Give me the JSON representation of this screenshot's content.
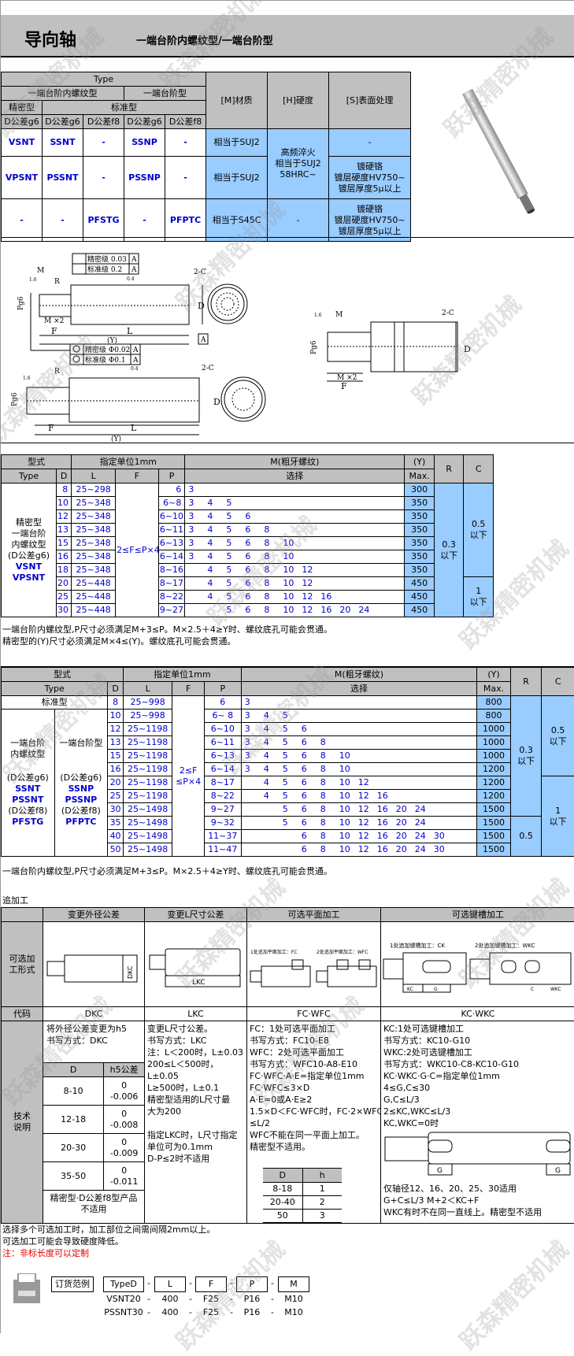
{
  "header": {
    "title": "导向轴",
    "subtitle": "一端台阶内螺纹型/一端台阶型"
  },
  "type_table": {
    "type_label": "Type",
    "group1": "一端台阶内螺纹型",
    "group2": "一端台阶型",
    "sub_precision": "精密型",
    "sub_standard": "标准型",
    "tol_cols": [
      "D公差g6",
      "D公差g6",
      "D公差f8",
      "D公差g6",
      "D公差f8"
    ],
    "material_header": "[M]材质",
    "hardness_header": "[H]硬度",
    "surface_header": "[S]表面处理",
    "rows": [
      {
        "codes": [
          "VSNT",
          "SSNT",
          "-",
          "SSNP",
          "-"
        ],
        "material": "相当于SUJ2",
        "surface": "-"
      },
      {
        "codes": [
          "VPSNT",
          "PSSNT",
          "-",
          "PSSNP",
          "-"
        ],
        "material": "相当于SUJ2",
        "surface": "镀硬铬\n镀层硬度HV750~\n镀层厚度5μ以上"
      },
      {
        "codes": [
          "-",
          "-",
          "PFSTG",
          "-",
          "PFPTC"
        ],
        "material": "相当于S45C",
        "hardness": "-",
        "surface": "镀硬铬\n镀层硬度HV750~\n镀层厚度5μ以上"
      }
    ],
    "hardness_merged": "高频淬火\n相当于SUJ2\n58HRC~"
  },
  "drawing_labels": {
    "perp_precision": "精密级 0.03",
    "perp_standard": "标准级 0.2",
    "conc_precision": "精密级 Φ0.02",
    "conc_standard": "标准级 Φ0.1",
    "datum": "A",
    "chamfer": "2-C",
    "dim_L": "L",
    "dim_F": "F",
    "dim_Y": "(Y)",
    "dim_D": "D",
    "dim_P": "Pg6",
    "dim_M": "M",
    "dim_M2": "M ×2",
    "radius": "R",
    "rough_16": "1.6",
    "rough_04": "0.4"
  },
  "table1": {
    "h_type": "型式",
    "h_unit": "指定单位1mm",
    "h_m": "M(粗牙螺纹)",
    "h_y": "(Y)",
    "h_r": "R",
    "h_c": "C",
    "h_type_en": "Type",
    "h_d": "D",
    "h_l": "L",
    "h_f": "F",
    "h_p": "P",
    "h_select": "选择",
    "h_max": "Max.",
    "type_cell": "精密型\n一端台阶\n内螺纹型\n(D公差g6)",
    "type_codes": [
      "VSNT",
      "VPSNT"
    ],
    "f_cell": "2≤F≤P×4",
    "r_cell": "0.3\n以下",
    "c_cells": [
      "0.5\n以下",
      "1\n以下"
    ],
    "rows": [
      {
        "d": "8",
        "l": "25~298",
        "p": "6",
        "m": [
          "3",
          "",
          "",
          "",
          "",
          "",
          "",
          "",
          ""
        ],
        "y": "300"
      },
      {
        "d": "10",
        "l": "25~348",
        "p": "6~8",
        "m": [
          "3",
          "4",
          "5",
          "",
          "",
          "",
          "",
          "",
          ""
        ],
        "y": "350"
      },
      {
        "d": "12",
        "l": "25~348",
        "p": "6~10",
        "m": [
          "3",
          "4",
          "5",
          "6",
          "",
          "",
          "",
          "",
          ""
        ],
        "y": "350"
      },
      {
        "d": "13",
        "l": "25~348",
        "p": "6~11",
        "m": [
          "3",
          "4",
          "5",
          "6",
          "8",
          "",
          "",
          "",
          ""
        ],
        "y": "350"
      },
      {
        "d": "15",
        "l": "25~348",
        "p": "6~13",
        "m": [
          "3",
          "4",
          "5",
          "6",
          "8",
          "10",
          "",
          "",
          ""
        ],
        "y": "350"
      },
      {
        "d": "16",
        "l": "25~348",
        "p": "6~14",
        "m": [
          "3",
          "4",
          "5",
          "6",
          "8",
          "10",
          "",
          "",
          ""
        ],
        "y": "350"
      },
      {
        "d": "18",
        "l": "25~348",
        "p": "8~16",
        "m": [
          "",
          "4",
          "5",
          "6",
          "8",
          "10",
          "12",
          "",
          ""
        ],
        "y": "350"
      },
      {
        "d": "20",
        "l": "25~448",
        "p": "8~17",
        "m": [
          "",
          "4",
          "5",
          "6",
          "8",
          "10",
          "12",
          "",
          ""
        ],
        "y": "450"
      },
      {
        "d": "25",
        "l": "25~448",
        "p": "8~22",
        "m": [
          "",
          "4",
          "5",
          "6",
          "8",
          "10",
          "12",
          "16",
          ""
        ],
        "y": "450"
      },
      {
        "d": "30",
        "l": "25~448",
        "p": "9~27",
        "m": [
          "",
          "",
          "5",
          "6",
          "8",
          "10",
          "12",
          "16",
          "20",
          "24"
        ],
        "y": "450"
      }
    ],
    "notes": [
      "一端台阶内螺纹型,P尺寸必须满足M+3≤P。M×2.5＋4≥Y时、螺纹底孔可能会贯通。",
      "精密型的(Y)尺寸必须满足M×4≤(Y)。螺纹底孔可能会贯通。"
    ]
  },
  "table2": {
    "h_type": "型式",
    "h_unit": "指定单位1mm",
    "h_m": "M(粗牙螺纹)",
    "h_y": "(Y)",
    "h_r": "R",
    "h_c": "C",
    "h_type_en": "Type",
    "h_d": "D",
    "h_l": "L",
    "h_f": "F",
    "h_p": "P",
    "h_select": "选择",
    "h_max": "Max.",
    "standard_label": "标准型",
    "col1_label": "一端台阶\n内螺纹型",
    "col1_tol_g6": "(D公差g6)",
    "col1_codes_g6": [
      "SSNT",
      "PSSNT"
    ],
    "col1_tol_f8": "(D公差f8)",
    "col1_code_f8": "PFSTG",
    "col2_label": "一端台阶型",
    "col2_tol_g6": "(D公差g6)",
    "col2_codes_g6": [
      "SSNP",
      "PSSNP"
    ],
    "col2_tol_f8": "(D公差f8)",
    "col2_code_f8": "PFPTC",
    "f_cell": "2≤F\n≤P×4",
    "r_cells": [
      "0.3\n以下",
      "0.5"
    ],
    "c_cells": [
      "0.5\n以下",
      "1\n以下"
    ],
    "rows": [
      {
        "d": "8",
        "l": "25~998",
        "p": "6",
        "m": [
          "3",
          "",
          "",
          "",
          "",
          "",
          "",
          "",
          "",
          ""
        ],
        "y": "800"
      },
      {
        "d": "10",
        "l": "25~998",
        "p": "6~ 8",
        "m": [
          "3",
          "4",
          "5",
          "",
          "",
          "",
          "",
          "",
          "",
          ""
        ],
        "y": "800"
      },
      {
        "d": "12",
        "l": "25~1198",
        "p": "6~10",
        "m": [
          "3",
          "4",
          "5",
          "6",
          "",
          "",
          "",
          "",
          "",
          ""
        ],
        "y": "1000"
      },
      {
        "d": "13",
        "l": "25~1198",
        "p": "6~11",
        "m": [
          "3",
          "4",
          "5",
          "6",
          "8",
          "",
          "",
          "",
          "",
          ""
        ],
        "y": "1000"
      },
      {
        "d": "15",
        "l": "25~1198",
        "p": "6~13",
        "m": [
          "3",
          "4",
          "5",
          "6",
          "8",
          "10",
          "",
          "",
          "",
          ""
        ],
        "y": "1000"
      },
      {
        "d": "16",
        "l": "25~1198",
        "p": "6~14",
        "m": [
          "3",
          "4",
          "5",
          "6",
          "8",
          "10",
          "",
          "",
          "",
          ""
        ],
        "y": "1200"
      },
      {
        "d": "20",
        "l": "25~1198",
        "p": "8~17",
        "m": [
          "",
          "4",
          "5",
          "6",
          "8",
          "10",
          "12",
          "",
          "",
          ""
        ],
        "y": "1200"
      },
      {
        "d": "25",
        "l": "25~1198",
        "p": "8~22",
        "m": [
          "",
          "4",
          "5",
          "6",
          "8",
          "10",
          "12",
          "16",
          "",
          ""
        ],
        "y": "1200"
      },
      {
        "d": "30",
        "l": "25~1498",
        "p": "9~27",
        "m": [
          "",
          "",
          "5",
          "6",
          "8",
          "10",
          "12",
          "16",
          "20",
          "24"
        ],
        "y": "1500"
      },
      {
        "d": "35",
        "l": "25~1498",
        "p": "9~32",
        "m": [
          "",
          "",
          "5",
          "6",
          "8",
          "10",
          "12",
          "16",
          "20",
          "24"
        ],
        "y": "1500"
      },
      {
        "d": "40",
        "l": "25~1498",
        "p": "11~37",
        "m": [
          "",
          "",
          "",
          "6",
          "8",
          "10",
          "12",
          "16",
          "20",
          "24",
          "30"
        ],
        "y": "1500"
      },
      {
        "d": "50",
        "l": "25~1498",
        "p": "11~47",
        "m": [
          "",
          "",
          "",
          "6",
          "8",
          "10",
          "12",
          "16",
          "20",
          "24",
          "30"
        ],
        "y": "1500"
      }
    ],
    "note": "一端台阶内螺纹型,P尺寸必须满足M+3≤P。M×2.5＋4≥Y时、螺纹底孔可能会贯通。"
  },
  "additional": {
    "section_title": "追加工",
    "columns": [
      "变更外径公差",
      "变更L尺寸公差",
      "可选平面加工",
      "可选键槽加工"
    ],
    "row_form_label": "可选加\n工形式",
    "row_code_label": "代码",
    "codes": [
      "DKC",
      "LKC",
      "FC·WFC",
      "KC·WKC"
    ],
    "row_tech_label": "技术\n说明",
    "fig_labels": {
      "dkc": "DKC",
      "lkc": "LKC",
      "fc_one": "1处追加平面加工：FC",
      "fc_two": "2处追加平面加工：WFC",
      "kc_one": "1处追加键槽加工：CK",
      "kc_two": "2处追加键槽加工：WKC",
      "kc": "KC",
      "g": "G",
      "c": "C",
      "wkc": "WKC"
    },
    "dkc_text": [
      "将外径公差变更为h5",
      "书写方式：DKC"
    ],
    "dkc_table": {
      "h_d": "D",
      "h_tol": "h5公差",
      "rows": [
        {
          "d": "8-10",
          "upper": "0",
          "lower": "-0.006"
        },
        {
          "d": "12-18",
          "upper": "0",
          "lower": "-0.008"
        },
        {
          "d": "20-30",
          "upper": "0",
          "lower": "-0.009"
        },
        {
          "d": "35-50",
          "upper": "0",
          "lower": "-0.011"
        }
      ],
      "footer": "精密型·D公差f8型产品\n不适用"
    },
    "lkc_text": [
      "变更L尺寸公差。",
      "书写方式：LKC",
      "注：L＜200时，L±0.03",
      "200≤L＜500时，L±0.05",
      "L≥500时，L±0.1",
      "精密型适用的L尺寸最",
      "大为200",
      "",
      "指定LKC时，L尺寸指定",
      "单位可为0.1mm",
      "D-P≤2时不适用"
    ],
    "fc_text": [
      "FC：1处可选平面加工",
      "书写方式：FC10-E8",
      "WFC：2处可选平面加工",
      "书写方式：WFC10-A8-E10",
      "FC·WFC·A·E=指定单位1mm",
      "FC·WFC≤3×D",
      "A·E=0或A·E≥2",
      "1.5×D＜FC·WFC时，FC·2×WFC",
      "≤L/2",
      "WFC不能在同一平面上加工。",
      "精密型不适用。"
    ],
    "fc_table": {
      "h_d": "D",
      "h_h": "h",
      "rows": [
        {
          "d": "8-18",
          "h": "1"
        },
        {
          "d": "20-40",
          "h": "2"
        },
        {
          "d": "50",
          "h": "3"
        }
      ]
    },
    "kc_text": [
      "KC:1处可选键槽加工",
      "书写方式：KC10-G10",
      "WKC:2处可选键槽加工",
      "书写方式：WKC10-C8-KC10-G10",
      "KC·WKC·G·C=指定单位1mm",
      "4≤G,C≤30",
      "G,C≤L/3",
      "2≤KC,WKC≤L/3",
      "KC,WKC=0时"
    ],
    "kc_text_after": [
      "仅轴径12、16、20、25、30适用",
      "G+C≤L/3  M+2＜KC+F",
      "WKC有时不在同一直线上。精密型不适用"
    ]
  },
  "footer_notes": {
    "line1": "选择多个可选加工时，加工部位之间需间隔2mm以上。",
    "line2": "可选加工可能会导致硬度降低。",
    "line3": "注：非标长度可以定制"
  },
  "order_example": {
    "label": "订货范例",
    "headers": [
      "TypeD",
      "L",
      "F",
      "P",
      "M"
    ],
    "rows": [
      [
        "VSNT20",
        "400",
        "F25",
        "P16",
        "M10"
      ],
      [
        "PSSNT30",
        "400",
        "F25",
        "P16",
        "M10"
      ]
    ],
    "sep": "-"
  },
  "watermark": "跃森精密机械",
  "colors": {
    "header_bg": "#c0c0c0",
    "highlight_blue": "#99ccff",
    "code_blue": "#0000cc",
    "note_red": "#e00000"
  }
}
